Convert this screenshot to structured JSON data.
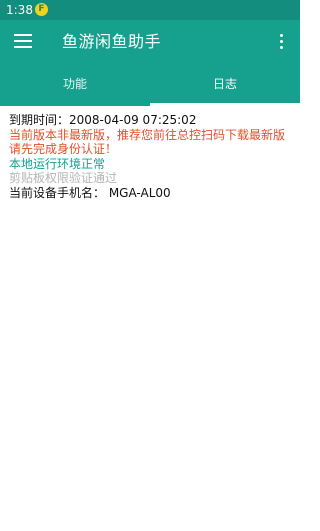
{
  "status_bar": {
    "time": "1:38",
    "badge": "F"
  },
  "app_bar": {
    "title": "鱼游闲鱼助手"
  },
  "tabs": [
    {
      "label": "功能"
    },
    {
      "label": "日志"
    }
  ],
  "log": [
    {
      "text": "到期时间：2008-04-09 07:25:02",
      "color": "#111111"
    },
    {
      "text": "当前版本非最新版，推荐您前往总控扫码下载最新版",
      "color": "#e3502b"
    },
    {
      "text": "请先完成身份认证！",
      "color": "#e3502b"
    },
    {
      "text": "本地运行环境正常",
      "color": "#15a18f"
    },
    {
      "text": "剪贴板权限验证通过",
      "color": "#b5b5b5"
    },
    {
      "text": "当前设备手机名： MGA-AL00",
      "color": "#111111"
    }
  ],
  "colors": {
    "primary": "#16a08e",
    "status_bar": "#138e7e"
  }
}
